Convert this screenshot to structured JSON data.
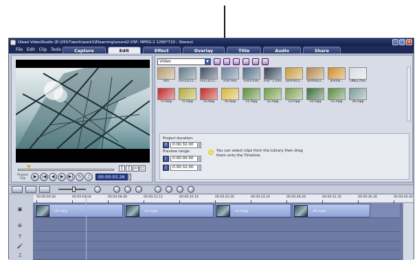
{
  "window": {
    "title": "Ulead VideoStudio (E:\\2557\\work\\work1\\Elearning\\sound2.VSP, MPEG-2 1280*720 - Stereo)"
  },
  "menu": [
    "File",
    "Edit",
    "Clip",
    "Tools"
  ],
  "steps": [
    {
      "label": "Capture",
      "active": false
    },
    {
      "label": "Edit",
      "active": true
    },
    {
      "label": "Effect",
      "active": false
    },
    {
      "label": "Overlay",
      "active": false
    },
    {
      "label": "Title",
      "active": false
    },
    {
      "label": "Audio",
      "active": false
    },
    {
      "label": "Share",
      "active": false
    }
  ],
  "player": {
    "project_clip": [
      "Project",
      "Clip"
    ],
    "timecode": "00:00:03.26"
  },
  "library": {
    "category": "Video",
    "items": [
      {
        "name": "V01",
        "color": "#b89a72"
      },
      {
        "name": "vvv13111...",
        "color": "#5c7a86"
      },
      {
        "name": "vvv13111...",
        "color": "#3f4d63"
      },
      {
        "name": "R3x.mov",
        "color": "#6a7f9e"
      },
      {
        "name": "R3cx.mov",
        "color": "#4d6a85"
      },
      {
        "name": "R3x^1.mov",
        "color": "#2e3f56"
      },
      {
        "name": "animalc3...",
        "color": "#c99a3a"
      },
      {
        "name": "animalc3...",
        "color": "#b3864d"
      },
      {
        "name": "animal...",
        "color": "#d08b2c"
      },
      {
        "name": "LINE2.mov",
        "color": "#d8dbe3"
      },
      {
        "name": "f1.mpg",
        "color": "#c0282a"
      },
      {
        "name": "f2.mpg",
        "color": "#b2a93a"
      },
      {
        "name": "f3.mpg",
        "color": "#c22a22"
      },
      {
        "name": "f4.mpg",
        "color": "#d9b53a"
      },
      {
        "name": "v1.mpg",
        "color": "#5b8f3a"
      },
      {
        "name": "v2.mpg",
        "color": "#6f9e45"
      },
      {
        "name": "v3.mpg",
        "color": "#7aa052"
      },
      {
        "name": "v4.mpg",
        "color": "#3d6e3a"
      },
      {
        "name": "v5.mpg",
        "color": "#5a8a44"
      },
      {
        "name": "v6.mpg",
        "color": "#7b9b9a"
      }
    ]
  },
  "options": {
    "project_duration_label": "Project duration:",
    "project_duration": "0:00:32:00",
    "preview_range_label": "Preview range:",
    "preview_start": "0:00:00:00",
    "preview_end": "0:00:32:00",
    "tip": "You can select clips from the Library then drag them onto the Timeline."
  },
  "ruler": {
    "ticks": [
      "00:00:00.00",
      "00:00:04.04",
      "00:00:08.08",
      "00:00:12.12",
      "00:00:16.16",
      "00:00:20.20",
      "00:00:24.24",
      "00:00:28.28",
      "00:00:32.32",
      "00:00:36.36",
      "00:00:40.40"
    ]
  },
  "timeline": {
    "clips": [
      "v5.mpg",
      "v3.mpg",
      "v4.mpg",
      "v6.mpg"
    ]
  }
}
